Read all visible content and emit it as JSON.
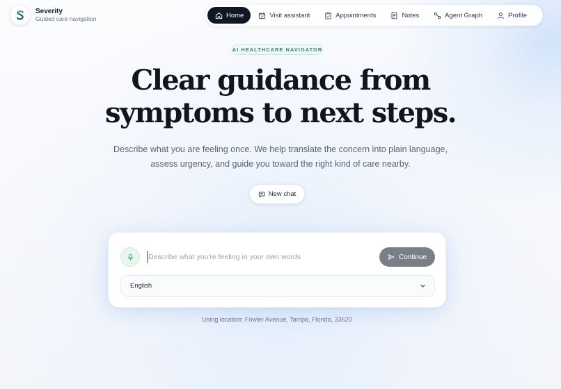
{
  "brand": {
    "name": "Severity",
    "tagline": "Guided care navigation",
    "logo_icon": "severity-s-logo"
  },
  "nav": {
    "items": [
      {
        "label": "Home",
        "icon": "home-icon",
        "active": true
      },
      {
        "label": "Visit assistant",
        "icon": "calendar-icon",
        "active": false
      },
      {
        "label": "Appointments",
        "icon": "clipboard-icon",
        "active": false
      },
      {
        "label": "Notes",
        "icon": "document-icon",
        "active": false
      },
      {
        "label": "Agent Graph",
        "icon": "graph-icon",
        "active": false
      },
      {
        "label": "Profile",
        "icon": "user-icon",
        "active": false
      }
    ]
  },
  "hero": {
    "eyebrow": "AI HEALTHCARE NAVIGATOR",
    "headline_line1": "Clear guidance from",
    "headline_line2": "symptoms to next steps.",
    "subtitle": "Describe what you are feeling once. We help translate the concern into plain language, assess urgency, and guide you toward the right kind of care nearby.",
    "new_chat_label": "New chat"
  },
  "composer": {
    "input_value": "",
    "input_placeholder": "Describe what you're feeling in your own words",
    "continue_label": "Continue",
    "language_selected": "English",
    "mic_icon": "microphone-icon",
    "send_icon": "send-icon"
  },
  "location": {
    "text": "Using location: Fowler Avenue, Tampa, Florida, 33620"
  },
  "colors": {
    "nav_active_bg": "#0f1624",
    "brand_teal": "#3d7f7a",
    "continue_button_bg": "#7a7f87",
    "mic_accent": "#3aa56d"
  }
}
